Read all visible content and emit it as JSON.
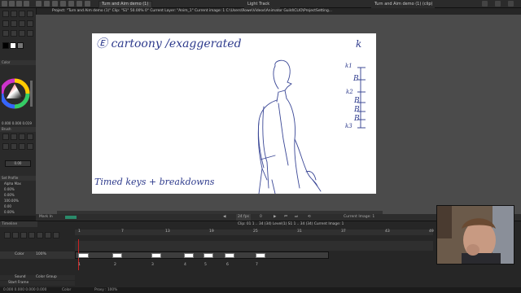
{
  "tabs": {
    "main_tab": "Turn and Aim demo (1)",
    "light_tab": "Light Track",
    "right_tab": "Turn and Aim demo (1) (clip)"
  },
  "titlebar": {
    "text": "Project: \"Turn and Aim demo (1)\"  Clip: \"S1\"  50.00%  0°  Current Layer: \"Anim_1\"  Current image: 1  C:\\Users\\Rowe\\Videos\\Animator Guild\\CLIO\\ProjectSetting..."
  },
  "left_panel": {
    "color_header": "Color",
    "hsv_value": "0.000  0.000  0.019",
    "brush_header": "Brush",
    "brush_value": "0.00",
    "props_header": "Set Profile",
    "props_sub": "Alpha Max",
    "props": [
      "0.00%",
      "0.00%",
      "100.00%",
      "0.00",
      "0.00%"
    ]
  },
  "canvas": {
    "title": "Ⓔ cartoony /exaggerated",
    "caption": "Timed keys + breakdowns",
    "chart_k": "k",
    "chart_labels": [
      "k1",
      "B",
      "k2",
      "B",
      "B",
      "B",
      "k3"
    ]
  },
  "playback": {
    "label": "Mark In",
    "fps": "24 fps",
    "frame": "0",
    "current": "Current Image: 1"
  },
  "timeline": {
    "header": "Timeline",
    "info": "Clip: 01  1 .. 34 (34)      Level(1)  S1  1 .. 34 (34)      Current Image: 1",
    "ruler": [
      "1",
      "7",
      "13",
      "19",
      "25",
      "31",
      "37",
      "43",
      "49"
    ],
    "key_numbers": [
      "1",
      "2",
      "3",
      "4",
      "5",
      "6",
      "7"
    ],
    "layer_labels": [
      "Color",
      "100%"
    ],
    "sound_label": "Sound",
    "color_group": "Color Group",
    "start_frame": "Start Frame"
  },
  "statusbar": {
    "left": "0.000 0.000 0.000  0.000",
    "middle": "Color",
    "right": "Proxy : 100%"
  },
  "colors": {
    "accent": "#2d3a8c",
    "canvas_bg": "#ffffff",
    "workspace": "#4b4b4b",
    "marker_red": "#cc2222"
  }
}
